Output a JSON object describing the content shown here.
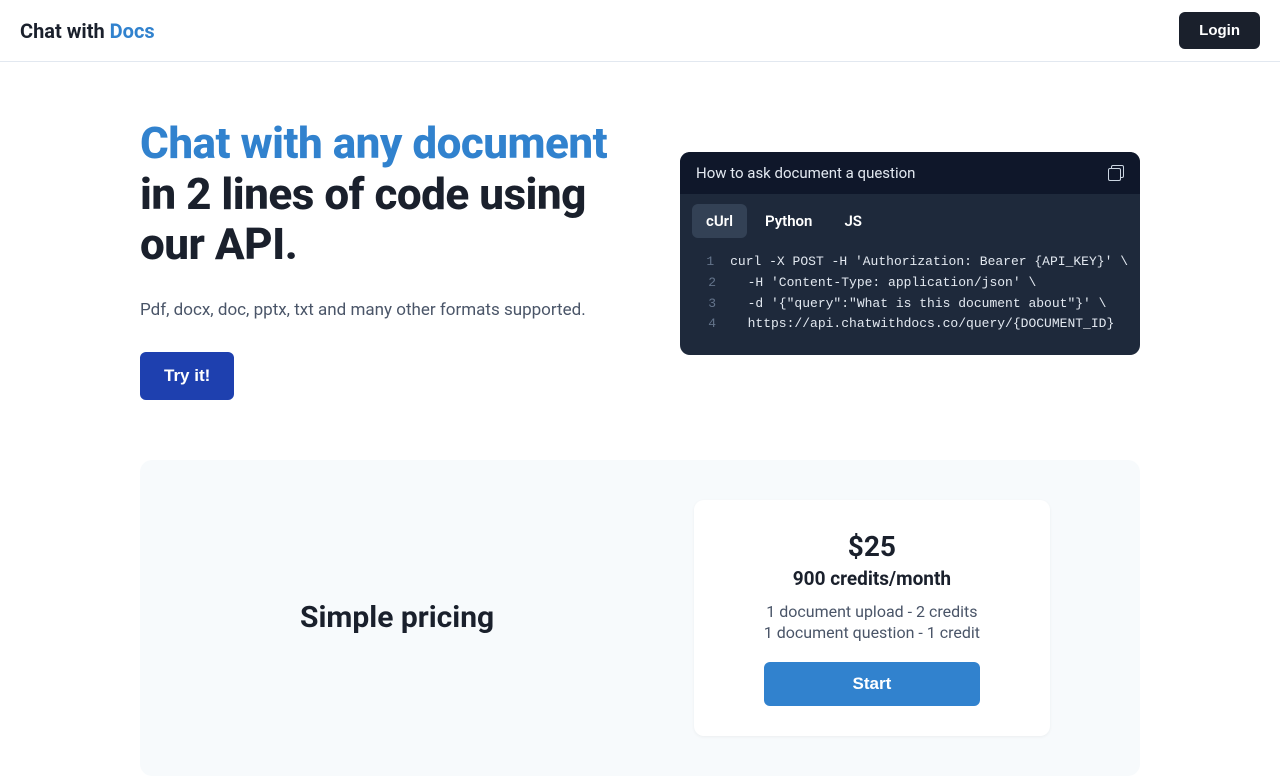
{
  "header": {
    "logo_prefix": "Chat with ",
    "logo_accent": "Docs",
    "login_label": "Login"
  },
  "hero": {
    "title_accent": "Chat with any document",
    "title_rest": " in 2 lines of code using our API.",
    "subtitle": "Pdf, docx, doc, pptx, txt and many other formats supported.",
    "try_label": "Try it!"
  },
  "code": {
    "title": "How to ask document a question",
    "tabs": [
      "cUrl",
      "Python",
      "JS"
    ],
    "active_tab_index": 0,
    "lines": [
      "curl -X POST -H 'Authorization: Bearer {API_KEY}' \\",
      "  -H 'Content-Type: application/json' \\",
      "  -d '{\"query\":\"What is this document about\"}' \\",
      "  https://api.chatwithdocs.co/query/{DOCUMENT_ID}"
    ]
  },
  "pricing": {
    "title": "Simple pricing",
    "price": "$25",
    "credits": "900 credits/month",
    "line1": "1 document upload - 2 credits",
    "line2": "1 document question - 1 credit",
    "start_label": "Start"
  }
}
